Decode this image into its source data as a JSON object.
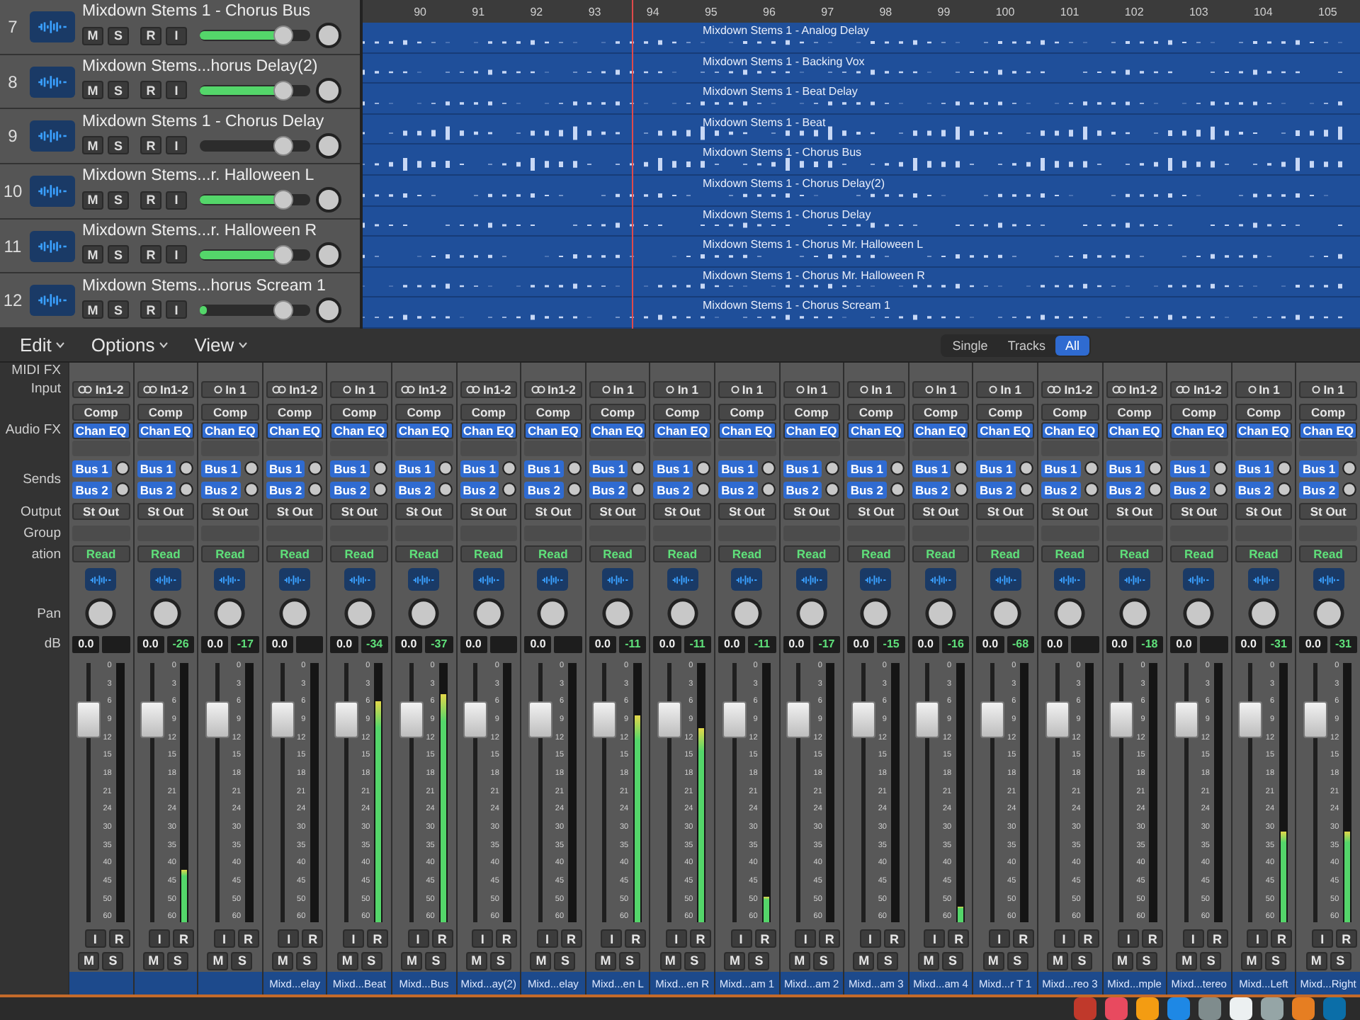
{
  "tracks": [
    {
      "number": "7",
      "name": "Mixdown Stems 1 - Chorus Bus",
      "buttons": [
        "M",
        "S",
        "R",
        "I"
      ],
      "volume": {
        "level": 0.75
      },
      "meter": {
        "level": 0.72
      }
    },
    {
      "number": "8",
      "name": "Mixdown Stems...horus Delay(2)",
      "buttons": [
        "M",
        "S",
        "R",
        "I"
      ],
      "volume": {
        "level": 0.75
      },
      "meter": {
        "level": 0.72
      }
    },
    {
      "number": "9",
      "name": "Mixdown Stems 1 - Chorus Delay",
      "buttons": [
        "M",
        "S",
        "R",
        "I"
      ],
      "volume": {
        "level": 0.75
      }
    },
    {
      "number": "10",
      "name": "Mixdown Stems...r. Halloween L",
      "buttons": [
        "M",
        "S",
        "R",
        "I"
      ],
      "volume": {
        "level": 0.75
      },
      "meter": {
        "level": 0.7
      }
    },
    {
      "number": "11",
      "name": "Mixdown Stems...r. Halloween R",
      "buttons": [
        "M",
        "S",
        "R",
        "I"
      ],
      "volume": {
        "level": 0.75
      },
      "meter": {
        "level": 0.7
      }
    },
    {
      "number": "12",
      "name": "Mixdown Stems...horus Scream 1",
      "buttons": [
        "M",
        "S",
        "R",
        "I"
      ],
      "volume": {
        "level": 0.75
      },
      "meter": {
        "level": 0.06
      }
    }
  ],
  "ruler": [
    "90",
    "91",
    "92",
    "93",
    "94",
    "95",
    "96",
    "97",
    "98",
    "99",
    "100",
    "101",
    "102",
    "103",
    "104",
    "105"
  ],
  "regions": [
    "Mixdown Stems 1 - Analog Delay",
    "Mixdown Stems 1 - Backing Vox",
    "Mixdown Stems 1 - Beat Delay",
    "Mixdown Stems 1 - Beat",
    "Mixdown Stems 1 - Chorus Bus",
    "Mixdown Stems 1 - Chorus Delay(2)",
    "Mixdown Stems 1 - Chorus Delay",
    "Mixdown Stems 1 - Chorus Mr. Halloween L",
    "Mixdown Stems 1 - Chorus Mr. Halloween R",
    "Mixdown Stems 1 - Chorus Scream 1"
  ],
  "mixer": {
    "menus": [
      "Edit",
      "Options",
      "View"
    ],
    "view_modes": [
      {
        "label": "Single",
        "selected": false
      },
      {
        "label": "Tracks",
        "selected": false
      },
      {
        "label": "All",
        "selected": true
      }
    ],
    "row_labels": {
      "midi": "MIDI FX",
      "input": "Input",
      "audio_fx": "Audio FX",
      "sends": "Sends",
      "output": "Output",
      "group": "Group",
      "automation": "ation",
      "pan": "Pan",
      "db": "dB"
    },
    "strips": [
      {
        "input": "In1-2",
        "stereo": true,
        "plugins": [
          "Comp",
          "Chan EQ"
        ],
        "sends": [
          "Bus 1",
          "Bus 2"
        ],
        "output": "St Out",
        "automation": "Read",
        "volume": "0.0",
        "fader": {
          "level": 0.78
        },
        "scale": [
          "0",
          "3",
          "6",
          "9",
          "12",
          "15",
          "18",
          "21",
          "24",
          "30",
          "35",
          "40",
          "45",
          "50",
          "60"
        ],
        "ir": [
          "I",
          "R"
        ],
        "ms": [
          "M",
          "S"
        ]
      },
      {
        "input": "In1-2",
        "stereo": true,
        "plugins": [
          "Comp",
          "Chan EQ"
        ],
        "sends": [
          "Bus 1",
          "Bus 2"
        ],
        "output": "St Out",
        "automation": "Read",
        "volume": "0.0",
        "peak": "-26",
        "fader": {
          "level": 0.78
        },
        "meter": {
          "level": 0.2
        },
        "scale": [
          "0",
          "3",
          "6",
          "9",
          "12",
          "15",
          "18",
          "21",
          "24",
          "30",
          "35",
          "40",
          "45",
          "50",
          "60"
        ],
        "ir": [
          "I",
          "R"
        ],
        "ms": [
          "M",
          "S"
        ]
      },
      {
        "input": "In 1",
        "stereo": false,
        "plugins": [
          "Comp",
          "Chan EQ"
        ],
        "sends": [
          "Bus 1",
          "Bus 2"
        ],
        "output": "St Out",
        "automation": "Read",
        "volume": "0.0",
        "peak": "-17",
        "fader": {
          "level": 0.78
        },
        "scale": [
          "0",
          "3",
          "6",
          "9",
          "12",
          "15",
          "18",
          "21",
          "24",
          "30",
          "35",
          "40",
          "45",
          "50",
          "60"
        ],
        "ir": [
          "I",
          "R"
        ],
        "ms": [
          "M",
          "S"
        ]
      },
      {
        "input": "In1-2",
        "stereo": true,
        "plugins": [
          "Comp",
          "Chan EQ"
        ],
        "sends": [
          "Bus 1",
          "Bus 2"
        ],
        "output": "St Out",
        "automation": "Read",
        "volume": "0.0",
        "fader": {
          "level": 0.78
        },
        "scale": [
          "0",
          "3",
          "6",
          "9",
          "12",
          "15",
          "18",
          "21",
          "24",
          "30",
          "35",
          "40",
          "45",
          "50",
          "60"
        ],
        "ir": [
          "I",
          "R"
        ],
        "ms": [
          "M",
          "S"
        ],
        "name": "Mixd...elay"
      },
      {
        "input": "In 1",
        "stereo": false,
        "plugins": [
          "Comp",
          "Chan EQ"
        ],
        "sends": [
          "Bus 1",
          "Bus 2"
        ],
        "output": "St Out",
        "automation": "Read",
        "volume": "0.0",
        "peak": "-34",
        "fader": {
          "level": 0.78
        },
        "meter": {
          "level": 0.85
        },
        "scale": [
          "0",
          "3",
          "6",
          "9",
          "12",
          "15",
          "18",
          "21",
          "24",
          "30",
          "35",
          "40",
          "45",
          "50",
          "60"
        ],
        "ir": [
          "I",
          "R"
        ],
        "ms": [
          "M",
          "S"
        ],
        "name": "Mixd...Beat"
      },
      {
        "input": "In1-2",
        "stereo": true,
        "plugins": [
          "Comp",
          "Chan EQ"
        ],
        "sends": [
          "Bus 1",
          "Bus 2"
        ],
        "output": "St Out",
        "automation": "Read",
        "volume": "0.0",
        "peak": "-37",
        "fader": {
          "level": 0.78
        },
        "meter": {
          "level": 0.88
        },
        "scale": [
          "0",
          "3",
          "6",
          "9",
          "12",
          "15",
          "18",
          "21",
          "24",
          "30",
          "35",
          "40",
          "45",
          "50",
          "60"
        ],
        "ir": [
          "I",
          "R"
        ],
        "ms": [
          "M",
          "S"
        ],
        "name": "Mixd...Bus"
      },
      {
        "input": "In1-2",
        "stereo": true,
        "plugins": [
          "Comp",
          "Chan EQ"
        ],
        "sends": [
          "Bus 1",
          "Bus 2"
        ],
        "output": "St Out",
        "automation": "Read",
        "volume": "0.0",
        "fader": {
          "level": 0.78
        },
        "scale": [
          "0",
          "3",
          "6",
          "9",
          "12",
          "15",
          "18",
          "21",
          "24",
          "30",
          "35",
          "40",
          "45",
          "50",
          "60"
        ],
        "ir": [
          "I",
          "R"
        ],
        "ms": [
          "M",
          "S"
        ],
        "name": "Mixd...ay(2)"
      },
      {
        "input": "In1-2",
        "stereo": true,
        "plugins": [
          "Comp",
          "Chan EQ"
        ],
        "sends": [
          "Bus 1",
          "Bus 2"
        ],
        "output": "St Out",
        "automation": "Read",
        "volume": "0.0",
        "fader": {
          "level": 0.78
        },
        "scale": [
          "0",
          "3",
          "6",
          "9",
          "12",
          "15",
          "18",
          "21",
          "24",
          "30",
          "35",
          "40",
          "45",
          "50",
          "60"
        ],
        "ir": [
          "I",
          "R"
        ],
        "ms": [
          "M",
          "S"
        ],
        "name": "Mixd...elay"
      },
      {
        "input": "In 1",
        "stereo": false,
        "plugins": [
          "Comp",
          "Chan EQ"
        ],
        "sends": [
          "Bus 1",
          "Bus 2"
        ],
        "output": "St Out",
        "automation": "Read",
        "volume": "0.0",
        "peak": "-11",
        "fader": {
          "level": 0.78
        },
        "meter": {
          "level": 0.8
        },
        "scale": [
          "0",
          "3",
          "6",
          "9",
          "12",
          "15",
          "18",
          "21",
          "24",
          "30",
          "35",
          "40",
          "45",
          "50",
          "60"
        ],
        "ir": [
          "I",
          "R"
        ],
        "ms": [
          "M",
          "S"
        ],
        "name": "Mixd...en L"
      },
      {
        "input": "In 1",
        "stereo": false,
        "plugins": [
          "Comp",
          "Chan EQ"
        ],
        "sends": [
          "Bus 1",
          "Bus 2"
        ],
        "output": "St Out",
        "automation": "Read",
        "volume": "0.0",
        "peak": "-11",
        "fader": {
          "level": 0.78
        },
        "meter": {
          "level": 0.75
        },
        "scale": [
          "0",
          "3",
          "6",
          "9",
          "12",
          "15",
          "18",
          "21",
          "24",
          "30",
          "35",
          "40",
          "45",
          "50",
          "60"
        ],
        "ir": [
          "I",
          "R"
        ],
        "ms": [
          "M",
          "S"
        ],
        "name": "Mixd...en R"
      },
      {
        "input": "In 1",
        "stereo": false,
        "plugins": [
          "Comp",
          "Chan EQ"
        ],
        "sends": [
          "Bus 1",
          "Bus 2"
        ],
        "output": "St Out",
        "automation": "Read",
        "volume": "0.0",
        "peak": "-11",
        "fader": {
          "level": 0.78
        },
        "meter": {
          "level": 0.1
        },
        "scale": [
          "0",
          "3",
          "6",
          "9",
          "12",
          "15",
          "18",
          "21",
          "24",
          "30",
          "35",
          "40",
          "45",
          "50",
          "60"
        ],
        "ir": [
          "I",
          "R"
        ],
        "ms": [
          "M",
          "S"
        ],
        "name": "Mixd...am 1"
      },
      {
        "input": "In 1",
        "stereo": false,
        "plugins": [
          "Comp",
          "Chan EQ"
        ],
        "sends": [
          "Bus 1",
          "Bus 2"
        ],
        "output": "St Out",
        "automation": "Read",
        "volume": "0.0",
        "peak": "-17",
        "fader": {
          "level": 0.78
        },
        "scale": [
          "0",
          "3",
          "6",
          "9",
          "12",
          "15",
          "18",
          "21",
          "24",
          "30",
          "35",
          "40",
          "45",
          "50",
          "60"
        ],
        "ir": [
          "I",
          "R"
        ],
        "ms": [
          "M",
          "S"
        ],
        "name": "Mixd...am 2"
      },
      {
        "input": "In 1",
        "stereo": false,
        "plugins": [
          "Comp",
          "Chan EQ"
        ],
        "sends": [
          "Bus 1",
          "Bus 2"
        ],
        "output": "St Out",
        "automation": "Read",
        "volume": "0.0",
        "peak": "-15",
        "fader": {
          "level": 0.78
        },
        "scale": [
          "0",
          "3",
          "6",
          "9",
          "12",
          "15",
          "18",
          "21",
          "24",
          "30",
          "35",
          "40",
          "45",
          "50",
          "60"
        ],
        "ir": [
          "I",
          "R"
        ],
        "ms": [
          "M",
          "S"
        ],
        "name": "Mixd...am 3"
      },
      {
        "input": "In 1",
        "stereo": false,
        "plugins": [
          "Comp",
          "Chan EQ"
        ],
        "sends": [
          "Bus 1",
          "Bus 2"
        ],
        "output": "St Out",
        "automation": "Read",
        "volume": "0.0",
        "peak": "-16",
        "fader": {
          "level": 0.78
        },
        "meter": {
          "level": 0.06
        },
        "scale": [
          "0",
          "3",
          "6",
          "9",
          "12",
          "15",
          "18",
          "21",
          "24",
          "30",
          "35",
          "40",
          "45",
          "50",
          "60"
        ],
        "ir": [
          "I",
          "R"
        ],
        "ms": [
          "M",
          "S"
        ],
        "name": "Mixd...am 4"
      },
      {
        "input": "In 1",
        "stereo": false,
        "plugins": [
          "Comp",
          "Chan EQ"
        ],
        "sends": [
          "Bus 1",
          "Bus 2"
        ],
        "output": "St Out",
        "automation": "Read",
        "volume": "0.0",
        "peak": "-68",
        "fader": {
          "level": 0.78
        },
        "scale": [
          "0",
          "3",
          "6",
          "9",
          "12",
          "15",
          "18",
          "21",
          "24",
          "30",
          "35",
          "40",
          "45",
          "50",
          "60"
        ],
        "ir": [
          "I",
          "R"
        ],
        "ms": [
          "M",
          "S"
        ],
        "name": "Mixd...r T 1"
      },
      {
        "input": "In1-2",
        "stereo": true,
        "plugins": [
          "Comp",
          "Chan EQ"
        ],
        "sends": [
          "Bus 1",
          "Bus 2"
        ],
        "output": "St Out",
        "automation": "Read",
        "volume": "0.0",
        "fader": {
          "level": 0.78
        },
        "scale": [
          "0",
          "3",
          "6",
          "9",
          "12",
          "15",
          "18",
          "21",
          "24",
          "30",
          "35",
          "40",
          "45",
          "50",
          "60"
        ],
        "ir": [
          "I",
          "R"
        ],
        "ms": [
          "M",
          "S"
        ],
        "name": "Mixd...reo 3"
      },
      {
        "input": "In1-2",
        "stereo": true,
        "plugins": [
          "Comp",
          "Chan EQ"
        ],
        "sends": [
          "Bus 1",
          "Bus 2"
        ],
        "output": "St Out",
        "automation": "Read",
        "volume": "0.0",
        "peak": "-18",
        "fader": {
          "level": 0.78
        },
        "scale": [
          "0",
          "3",
          "6",
          "9",
          "12",
          "15",
          "18",
          "21",
          "24",
          "30",
          "35",
          "40",
          "45",
          "50",
          "60"
        ],
        "ir": [
          "I",
          "R"
        ],
        "ms": [
          "M",
          "S"
        ],
        "name": "Mixd...mple"
      },
      {
        "input": "In1-2",
        "stereo": true,
        "plugins": [
          "Comp",
          "Chan EQ"
        ],
        "sends": [
          "Bus 1",
          "Bus 2"
        ],
        "output": "St Out",
        "automation": "Read",
        "volume": "0.0",
        "fader": {
          "level": 0.78
        },
        "scale": [
          "0",
          "3",
          "6",
          "9",
          "12",
          "15",
          "18",
          "21",
          "24",
          "30",
          "35",
          "40",
          "45",
          "50",
          "60"
        ],
        "ir": [
          "I",
          "R"
        ],
        "ms": [
          "M",
          "S"
        ],
        "name": "Mixd...tereo"
      },
      {
        "input": "In 1",
        "stereo": false,
        "plugins": [
          "Comp",
          "Chan EQ"
        ],
        "sends": [
          "Bus 1",
          "Bus 2"
        ],
        "output": "St Out",
        "automation": "Read",
        "volume": "0.0",
        "peak": "-31",
        "fader": {
          "level": 0.78
        },
        "meter": {
          "level": 0.35
        },
        "scale": [
          "0",
          "3",
          "6",
          "9",
          "12",
          "15",
          "18",
          "21",
          "24",
          "30",
          "35",
          "40",
          "45",
          "50",
          "60"
        ],
        "ir": [
          "I",
          "R"
        ],
        "ms": [
          "M",
          "S"
        ],
        "name": "Mixd...Left"
      },
      {
        "input": "In 1",
        "stereo": false,
        "plugins": [
          "Comp",
          "Chan EQ"
        ],
        "sends": [
          "Bus 1",
          "Bus 2"
        ],
        "output": "St Out",
        "automation": "Read",
        "volume": "0.0",
        "peak": "-31",
        "fader": {
          "level": 0.78
        },
        "meter": {
          "level": 0.35
        },
        "scale": [
          "0",
          "3",
          "6",
          "9",
          "12",
          "15",
          "18",
          "21",
          "24",
          "30",
          "35",
          "40",
          "45",
          "50",
          "60"
        ],
        "ir": [
          "I",
          "R"
        ],
        "ms": [
          "M",
          "S"
        ],
        "name": "Mixd...Right"
      }
    ]
  },
  "dock": [
    {
      "color": "#c0392b"
    },
    {
      "color": "#e84a5f"
    },
    {
      "color": "#f39c12"
    },
    {
      "color": "#1e88e5"
    },
    {
      "color": "#7f8c8d"
    },
    {
      "color": "#ecf0f1"
    },
    {
      "color": "#95a5a6"
    },
    {
      "color": "#e67e22"
    },
    {
      "color": "#0b6ea8"
    }
  ]
}
